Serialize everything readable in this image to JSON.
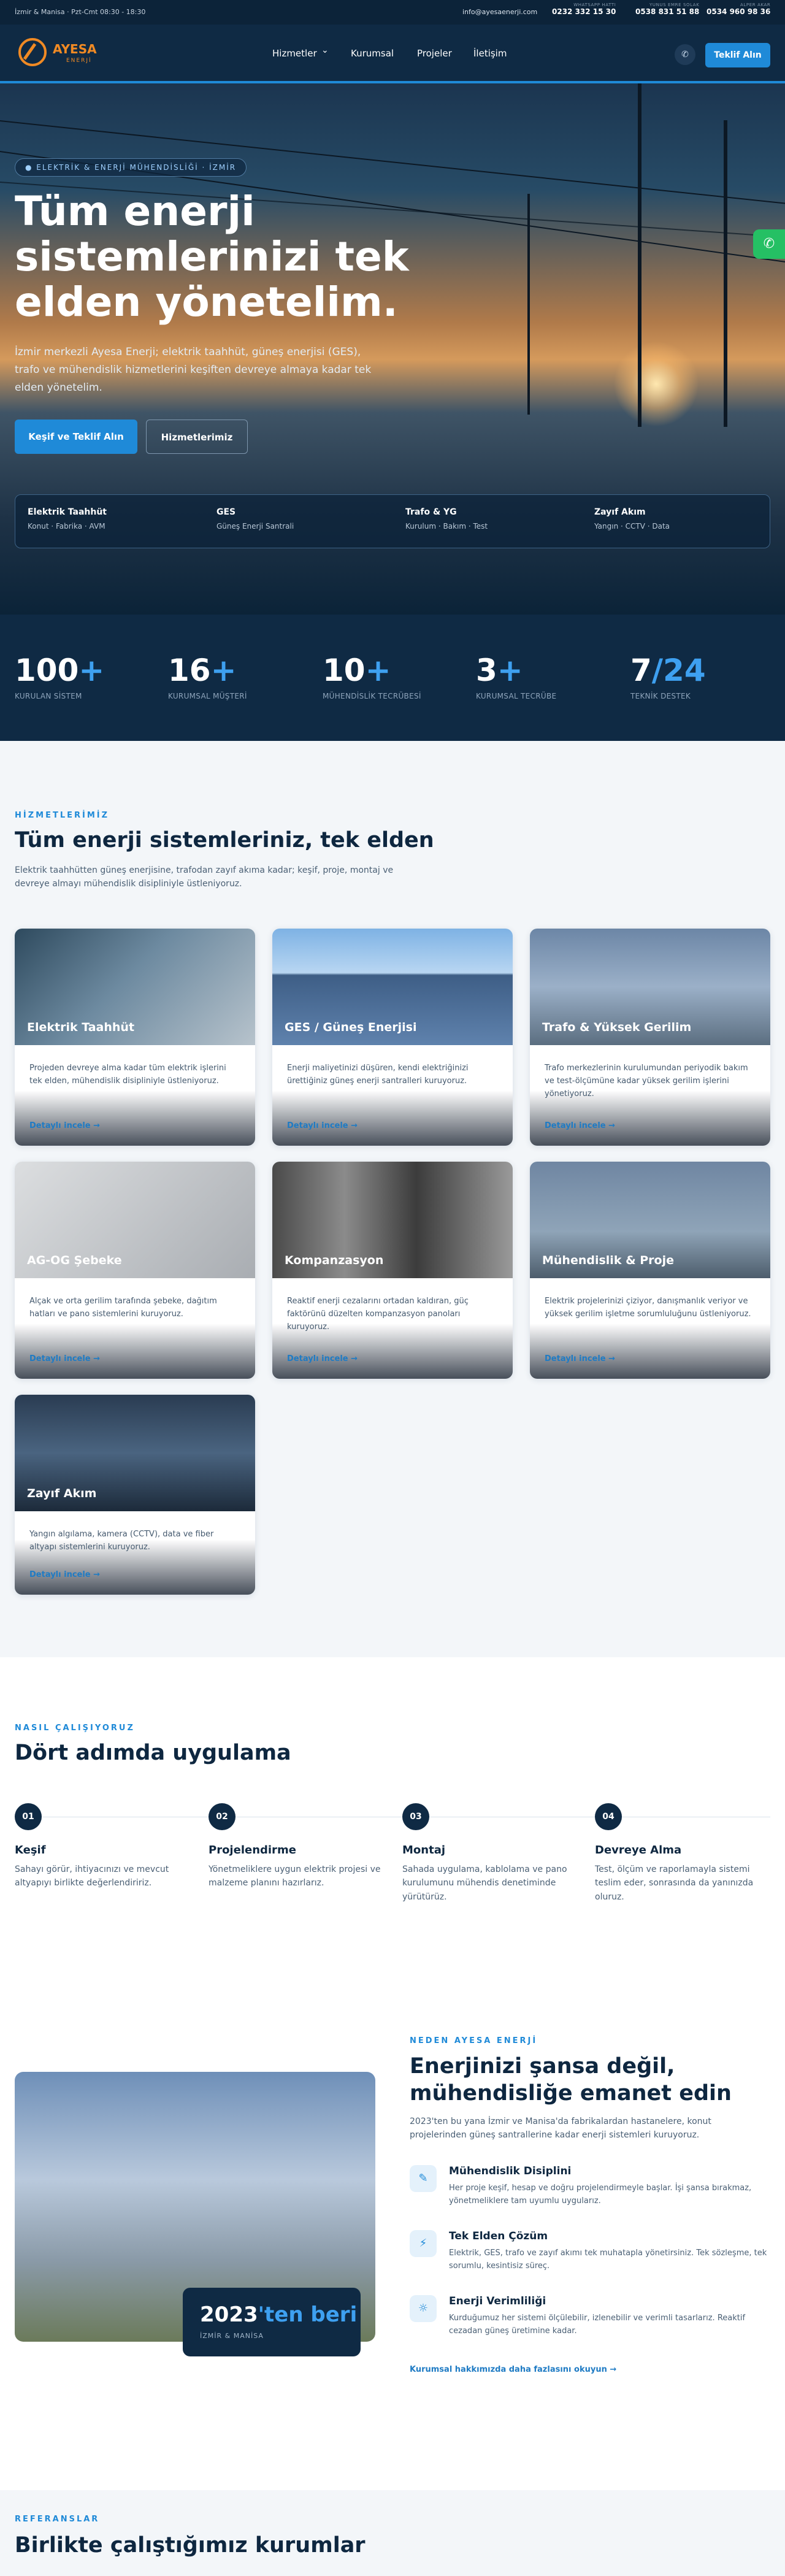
{
  "topbar": {
    "location": "İzmir & Manisa · Pzt-Cmt 08:30 - 18:30",
    "email": "info@ayesaenerji.com",
    "phones": [
      {
        "label": "WHATSAPP HATTI",
        "number": "0232 332 15 30"
      },
      {
        "label": "YUNUS EMRE SOLAK",
        "number": "0538 831 51 88"
      },
      {
        "label": "ALPER AKAR",
        "number": "0534 960 98 36"
      }
    ]
  },
  "nav": {
    "brand": "AYESA",
    "brand_sub": "ENERJİ",
    "items": [
      "Hizmetler",
      "Kurumsal",
      "Projeler",
      "İletişim"
    ],
    "chevron": "⌄",
    "phone_icon": "✆",
    "cta": "Teklif Alın"
  },
  "hero": {
    "badge": "● ELEKTRİK & ENERJİ MÜHENDİSLİĞİ · İZMİR",
    "title": "Tüm enerji sistemlerinizi tek elden yönetelim.",
    "subtitle": "İzmir merkezli Ayesa Enerji; elektrik taahhüt, güneş enerjisi (GES), trafo ve mühendislik hizmetlerini keşiften devreye almaya kadar tek elden yönetelim.",
    "primary_button": "Keşif ve Teklif Alın",
    "secondary_button": "Hizmetlerimiz",
    "highlights": [
      {
        "title": "Elektrik Taahhüt",
        "sub": "Konut · Fabrika · AVM"
      },
      {
        "title": "GES",
        "sub": "Güneş Enerji Santrali"
      },
      {
        "title": "Trafo & YG",
        "sub": "Kurulum · Bakım · Test"
      },
      {
        "title": "Zayıf Akım",
        "sub": "Yangın · CCTV · Data"
      }
    ]
  },
  "stats": [
    {
      "num": "100",
      "suffix": "+",
      "label": "KURULAN SİSTEM"
    },
    {
      "num": "16",
      "suffix": "+",
      "label": "KURUMSAL MÜŞTERİ"
    },
    {
      "num": "10",
      "suffix": "+",
      "label": "MÜHENDİSLİK TECRÜBESİ"
    },
    {
      "num": "3",
      "suffix": "+",
      "label": "KURUMSAL TECRÜBE"
    },
    {
      "num": "7",
      "suffix": "/24",
      "label": "TEKNİK DESTEK"
    }
  ],
  "services": {
    "kicker": "HİZMETLERİMİZ",
    "title": "Tüm enerji sistemleriniz, tek elden",
    "subtitle": "Elektrik taahhütten güneş enerjisine, trafodan zayıf akıma kadar; keşif, proje, montaj ve devreye almayı mühendislik disipliniyle üstleniyoruz.",
    "more": "Detaylı incele  →",
    "cards": [
      {
        "title": "Elektrik Taahhüt",
        "desc": "Projeden devreye alma kadar tüm elektrik işlerini tek elden, mühendislik disipliniyle üstleniyoruz."
      },
      {
        "title": "GES / Güneş Enerjisi",
        "desc": "Enerji maliyetinizi düşüren, kendi elektriğinizi ürettiğiniz güneş enerji santralleri kuruyoruz."
      },
      {
        "title": "Trafo & Yüksek Gerilim",
        "desc": "Trafo merkezlerinin kurulumundan periyodik bakım ve test-ölçümüne kadar yüksek gerilim işlerini yönetiyoruz."
      },
      {
        "title": "AG-OG Şebeke",
        "desc": "Alçak ve orta gerilim tarafında şebeke, dağıtım hatları ve pano sistemlerini kuruyoruz."
      },
      {
        "title": "Kompanzasyon",
        "desc": "Reaktif enerji cezalarını ortadan kaldıran, güç faktörünü düzelten kompanzasyon panoları kuruyoruz."
      },
      {
        "title": "Mühendislik & Proje",
        "desc": "Elektrik projelerinizi çiziyor, danışmanlık veriyor ve yüksek gerilim işletme sorumluluğunu üstleniyoruz."
      },
      {
        "title": "Zayıf Akım",
        "desc": "Yangın algılama, kamera (CCTV), data ve fiber altyapı sistemlerini kuruyoruz."
      }
    ]
  },
  "process": {
    "kicker": "NASIL ÇALIŞIYORUZ",
    "title": "Dört adımda uygulama",
    "steps": [
      {
        "num": "01",
        "title": "Keşif",
        "desc": "Sahayı görür, ihtiyacınızı ve mevcut altyapıyı birlikte değerlendiririz."
      },
      {
        "num": "02",
        "title": "Projelendirme",
        "desc": "Yönetmeliklere uygun elektrik projesi ve malzeme planını hazırlarız."
      },
      {
        "num": "03",
        "title": "Montaj",
        "desc": "Sahada uygulama, kablolama ve pano kurulumunu mühendis denetiminde yürütürüz."
      },
      {
        "num": "04",
        "title": "Devreye Alma",
        "desc": "Test, ölçüm ve raporlamayla sistemi teslim eder, sonrasında da yanınızda oluruz."
      }
    ]
  },
  "why": {
    "kicker": "NEDEN AYESA ENERJİ",
    "title": "Enerjinizi şansa değil, mühendisliğe emanet edin",
    "intro": "2023'ten bu yana İzmir ve Manisa'da fabrikalardan hastanelere, konut projelerinden güneş santrallerine kadar enerji sistemleri kuruyoruz.",
    "badge_year": "2023",
    "badge_year_suffix": "'ten beri",
    "badge_sub": "İZMİR & MANİSA",
    "features": [
      {
        "icon": "✎",
        "title": "Mühendislik Disiplini",
        "desc": "Her proje keşif, hesap ve doğru projelendirmeyle başlar. İşi şansa bırakmaz, yönetmeliklere tam uyumlu uygularız."
      },
      {
        "icon": "⚡",
        "title": "Tek Elden Çözüm",
        "desc": "Elektrik, GES, trafo ve zayıf akımı tek muhatapla yönetirsiniz. Tek sözleşme, tek sorumlu, kesintisiz süreç."
      },
      {
        "icon": "☼",
        "title": "Enerji Verimliliği",
        "desc": "Kurduğumuz her sistemi ölçülebilir, izlenebilir ve verimli tasarlarız. Reaktif cezadan güneş üretimine kadar."
      }
    ],
    "link": "Kurumsal hakkımızda daha fazlasını okuyun →"
  },
  "references": {
    "kicker": "REFERANSLAR",
    "title": "Birlikte çalıştığımız kurumlar"
  },
  "whatsapp_icon": "✆",
  "colors": {
    "primary": "#1f8ad8",
    "navy": "#0f2a44",
    "brand_orange": "#f08a24",
    "whatsapp": "#25c064"
  }
}
